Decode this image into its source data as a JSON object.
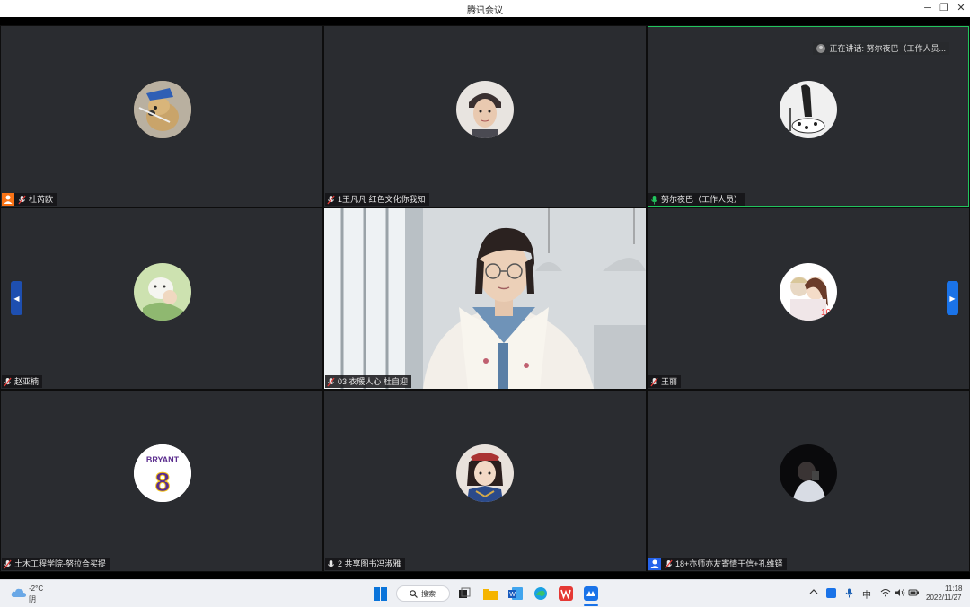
{
  "window": {
    "title": "腾讯会议",
    "minimize": "─",
    "restore": "❐",
    "close": "✕"
  },
  "speaking": {
    "label": "正在讲话: 努尔夜巴（工作人员..."
  },
  "participants": [
    {
      "name": "杜芮欧",
      "host_badge": true
    },
    {
      "name": "1王凡凡 红色文化你我知",
      "host_badge": false
    },
    {
      "name": "努尔夜巴（工作人员）",
      "host_badge": false,
      "mic_active": true
    },
    {
      "name": "赵亚楠",
      "host_badge": false
    },
    {
      "name": "03 衣暖人心 杜自迎",
      "host_badge": false
    },
    {
      "name": "王丽",
      "host_badge": false
    },
    {
      "name": "土木工程学院-努拉合买提",
      "host_badge": false
    },
    {
      "name": "2 共享图书冯淑雅",
      "host_badge": false
    },
    {
      "name": "18+亦师亦友寄情于信+孔维铎",
      "host_badge": true
    }
  ],
  "jersey": {
    "text": "BRYANT",
    "number": "8"
  },
  "taskbar": {
    "weather_temp": "-2°C",
    "weather_desc": "阴",
    "search_label": "搜索",
    "ime": "中",
    "time": "11:18",
    "date": "2022/11/27"
  },
  "colors": {
    "tile_bg": "#2a2c30",
    "speaking_border": "#22c55e",
    "host_badge": "#f97316",
    "cohost_badge": "#2563eb",
    "nav_arrow": "#1a73e8"
  }
}
